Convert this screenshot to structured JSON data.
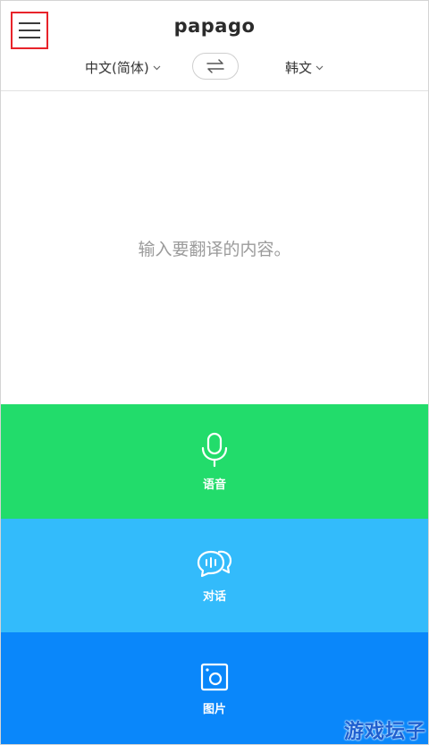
{
  "header": {
    "title": "papago"
  },
  "language": {
    "source": "中文(简体)",
    "target": "韩文"
  },
  "input": {
    "placeholder": "输入要翻译的内容。"
  },
  "modes": {
    "voice": {
      "label": "语音",
      "icon": "microphone-icon"
    },
    "conversation": {
      "label": "对话",
      "icon": "chat-bubbles-icon"
    },
    "image": {
      "label": "图片",
      "icon": "camera-icon"
    }
  },
  "watermark": {
    "text": "游戏坛子"
  },
  "colors": {
    "voice": "#22dc6b",
    "conversation": "#33bbfb",
    "image": "#0a87fa",
    "highlight": "#e8232a"
  }
}
